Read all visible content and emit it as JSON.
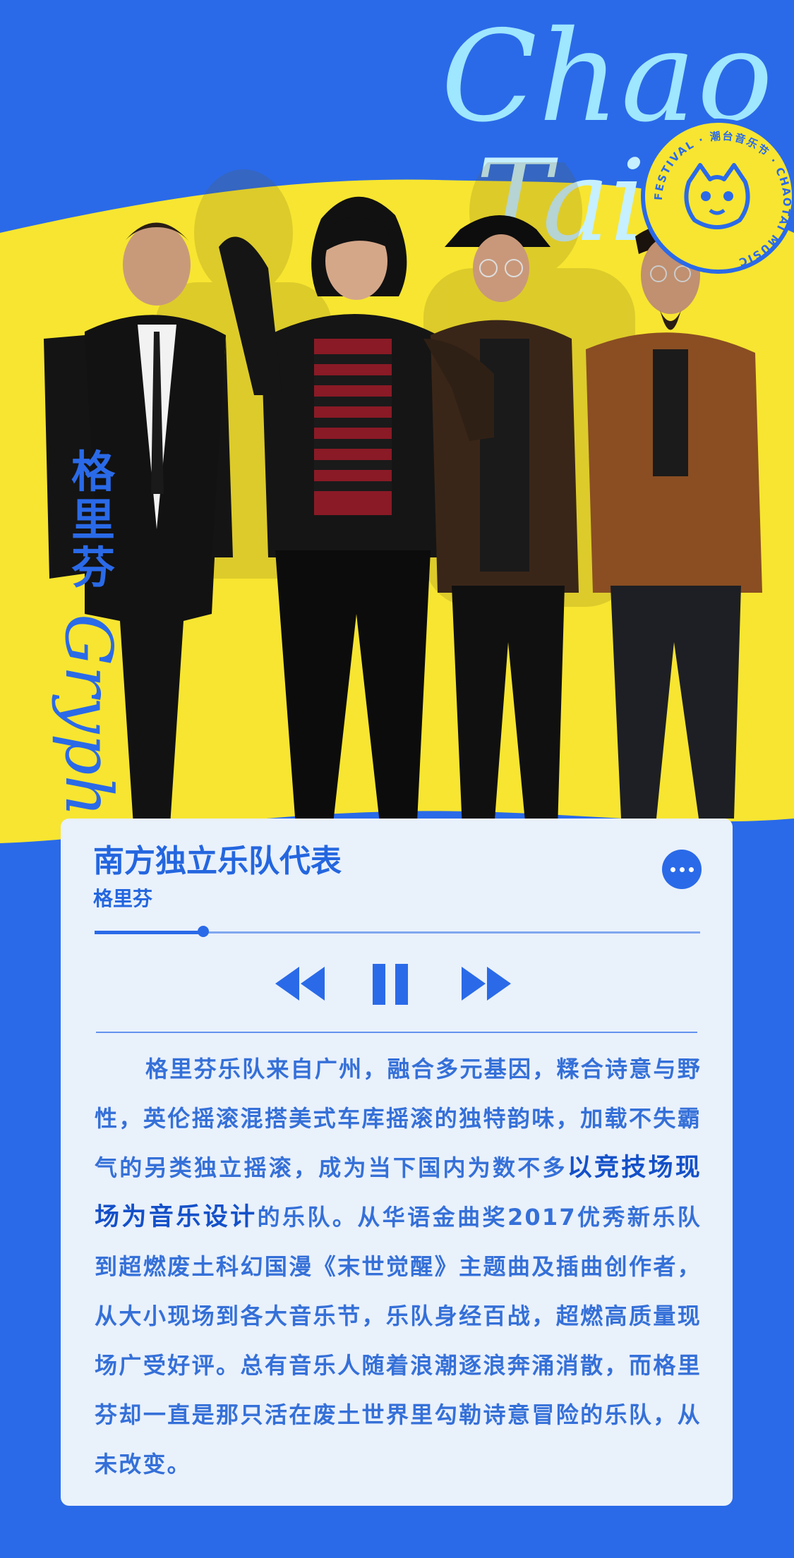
{
  "header": {
    "script_text_1": "Chao",
    "script_text_2": "Tai",
    "badge_text": "FESTIVAL · 潮台音乐节 · CHAOTAI MUSIC"
  },
  "band": {
    "name_cn": "格里芬",
    "name_en": "Gryphin"
  },
  "player": {
    "title": "南方独立乐队代表",
    "artist": "格里芬",
    "progress": 0.18,
    "more_icon": "more-dots-icon",
    "controls": [
      "rewind-icon",
      "pause-icon",
      "fast-forward-icon"
    ]
  },
  "description": {
    "part1": "格里芬乐队来自广州，融合多元基因，糅合诗意与野性，英伦摇滚混搭美式车库摇滚的独特韵味，加载不失霸气的另类独立摇滚，成为当下国内为数不多",
    "highlight": "以竞技场现场为音乐设计",
    "part2": "的乐队。从华语金曲奖2017优秀新乐队到超燃废土科幻国漫《末世觉醒》主题曲及插曲创作者，从大小现场到各大音乐节，乐队身经百战，超燃高质量现场广受好评。总有音乐人随着浪潮逐浪奔涌消散，而格里芬却一直是那只活在废土世界里勾勒诗意冒险的乐队，从未改变。"
  },
  "colors": {
    "brand_blue": "#2a6ae8",
    "yellow": "#f7e531",
    "card_bg": "#e9f1fb",
    "script_cyan": "#9fe6ff"
  }
}
